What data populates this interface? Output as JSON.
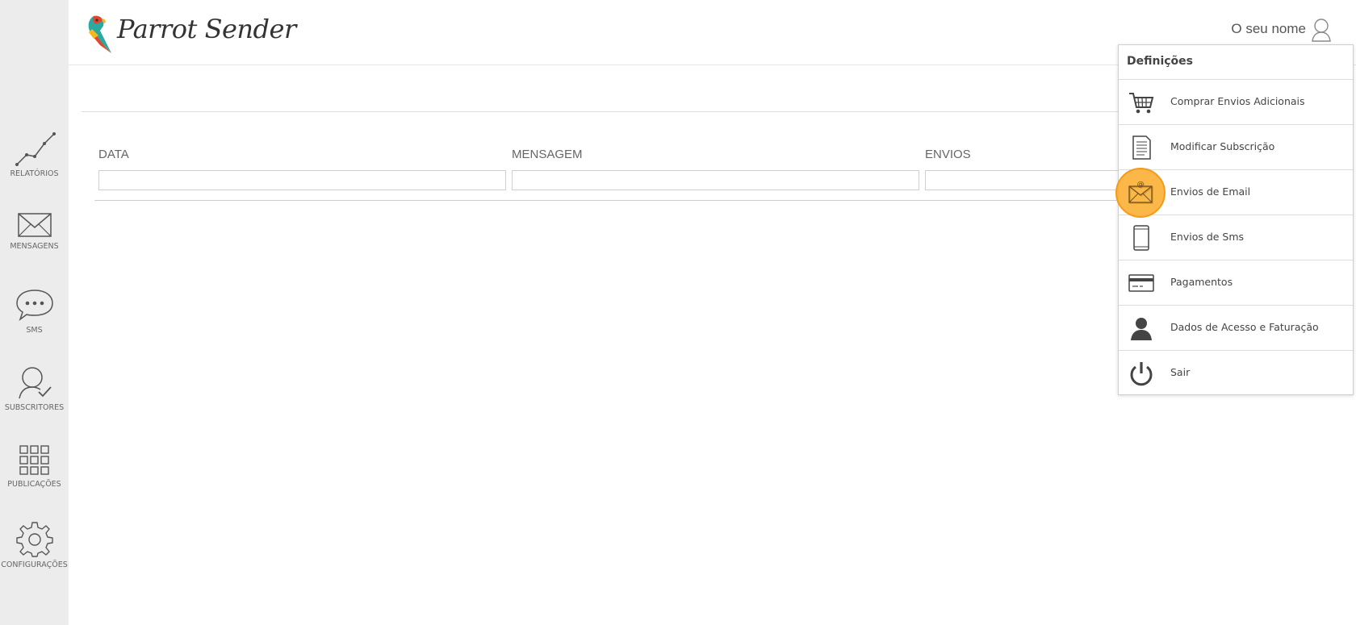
{
  "app": {
    "name": "Parrot Sender"
  },
  "header": {
    "user_name": "O seu nome"
  },
  "sidebar": {
    "items": [
      {
        "label": "RELATÓRIOS",
        "icon": "chart-line-icon"
      },
      {
        "label": "MENSAGENS",
        "icon": "envelope-icon"
      },
      {
        "label": "SMS",
        "icon": "chat-bubble-icon"
      },
      {
        "label": "SUBSCRITORES",
        "icon": "user-check-icon"
      },
      {
        "label": "PUBLICAÇÕES",
        "icon": "grid-icon"
      },
      {
        "label": "CONFIGURAÇÕES",
        "icon": "gear-icon"
      }
    ]
  },
  "table": {
    "columns": [
      {
        "label": "DATA"
      },
      {
        "label": "MENSAGEM"
      },
      {
        "label": "ENVIOS"
      }
    ]
  },
  "dropdown": {
    "title": "Definições",
    "items": [
      {
        "label": "Comprar Envios Adicionais",
        "icon": "cart-icon"
      },
      {
        "label": "Modificar Subscrição",
        "icon": "document-icon"
      },
      {
        "label": "Envios de Email",
        "icon": "email-at-icon",
        "highlighted": true
      },
      {
        "label": "Envios de Sms",
        "icon": "phone-icon"
      },
      {
        "label": "Pagamentos",
        "icon": "credit-card-icon"
      },
      {
        "label": "Dados de Acesso e Faturação",
        "icon": "person-icon"
      },
      {
        "label": "Sair",
        "icon": "power-icon"
      }
    ]
  },
  "colors": {
    "highlight": "#f49b1a",
    "sidebar_bg": "#ececec"
  }
}
